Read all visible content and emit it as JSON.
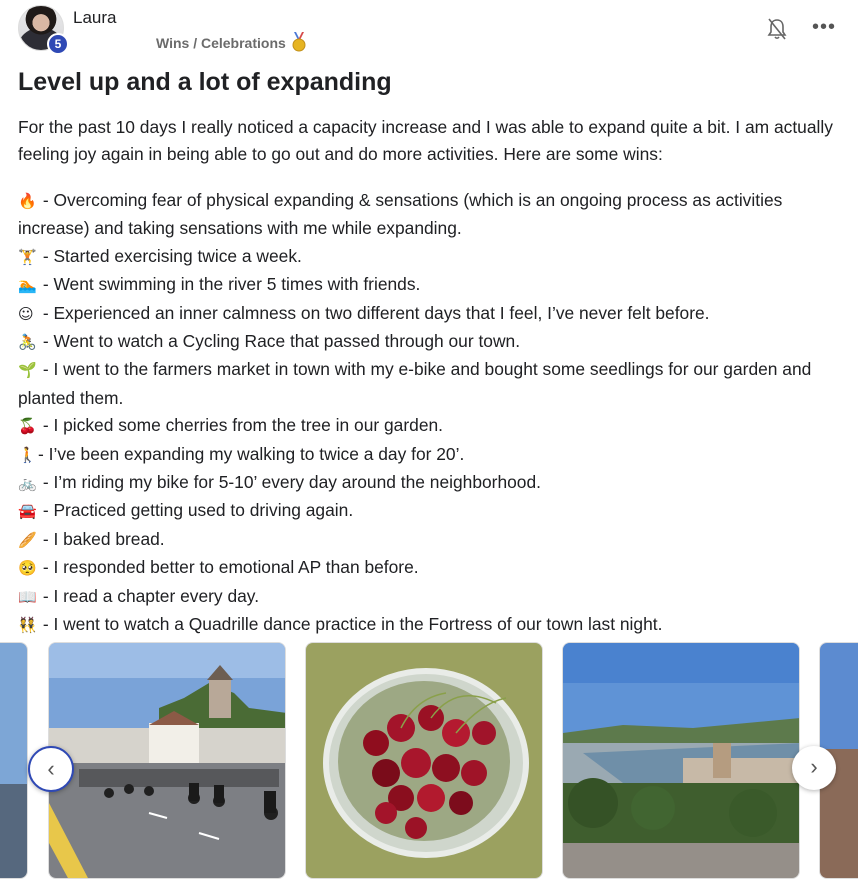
{
  "post": {
    "author": {
      "name": "Laura",
      "level": "5"
    },
    "category": "Wins / Celebrations",
    "title": "Level up and a lot of expanding",
    "intro": "For the past 10 days I really noticed a capacity increase and I was able to expand quite a bit. I am actually feeling joy again in being able to go out and do more activities. Here are some wins:",
    "wins": [
      {
        "emoji": "🔥",
        "text": " - Overcoming fear of physical expanding & sensations (which is an ongoing process as activities increase) and taking sensations with me while expanding."
      },
      {
        "emoji": "🏋",
        "text": " - Started exercising twice a week."
      },
      {
        "emoji": "🏊",
        "text": " - Went swimming in the river 5 times with friends."
      },
      {
        "emoji": "☺",
        "text": " - Experienced an inner calmness on two different days that I feel, I’ve never felt before."
      },
      {
        "emoji": "🚴",
        "text": " - Went to watch a Cycling Race that passed through our town."
      },
      {
        "emoji": "🌱",
        "text": " - I went to the farmers market in town with my e-bike and bought some seedlings for our garden and planted them."
      },
      {
        "emoji": "🍒",
        "text": " - I picked some cherries from the tree in our garden."
      },
      {
        "emoji": "🚶",
        "text": "- I’ve been expanding my walking to twice a day for 20’."
      },
      {
        "emoji": "🚲",
        "text": " - I’m riding my bike for 5-10’ every day around the neighborhood."
      },
      {
        "emoji": "🚘",
        "text": " - Practiced getting used to driving again."
      },
      {
        "emoji": "🥖",
        "text": " - I baked bread."
      },
      {
        "emoji": "🥺",
        "text": " - I responded better to emotional AP than before."
      },
      {
        "emoji": "📖",
        "text": " - I read a chapter every day."
      },
      {
        "emoji": "👯",
        "text": " - I went to watch a Quadrille dance practice in the Fortress of our town last night."
      }
    ]
  },
  "icons": {
    "medal": "medal-icon",
    "bell": "bell-off-icon",
    "more": "more-horizontal-icon",
    "prev": "chevron-left-icon",
    "next": "chevron-right-icon"
  },
  "gallery": {
    "prev_glyph": "‹",
    "next_glyph": "›",
    "more_glyph": "•••"
  },
  "colors": {
    "accent": "#2f49b5",
    "text": "#202124",
    "muted": "#6b6b6b"
  }
}
